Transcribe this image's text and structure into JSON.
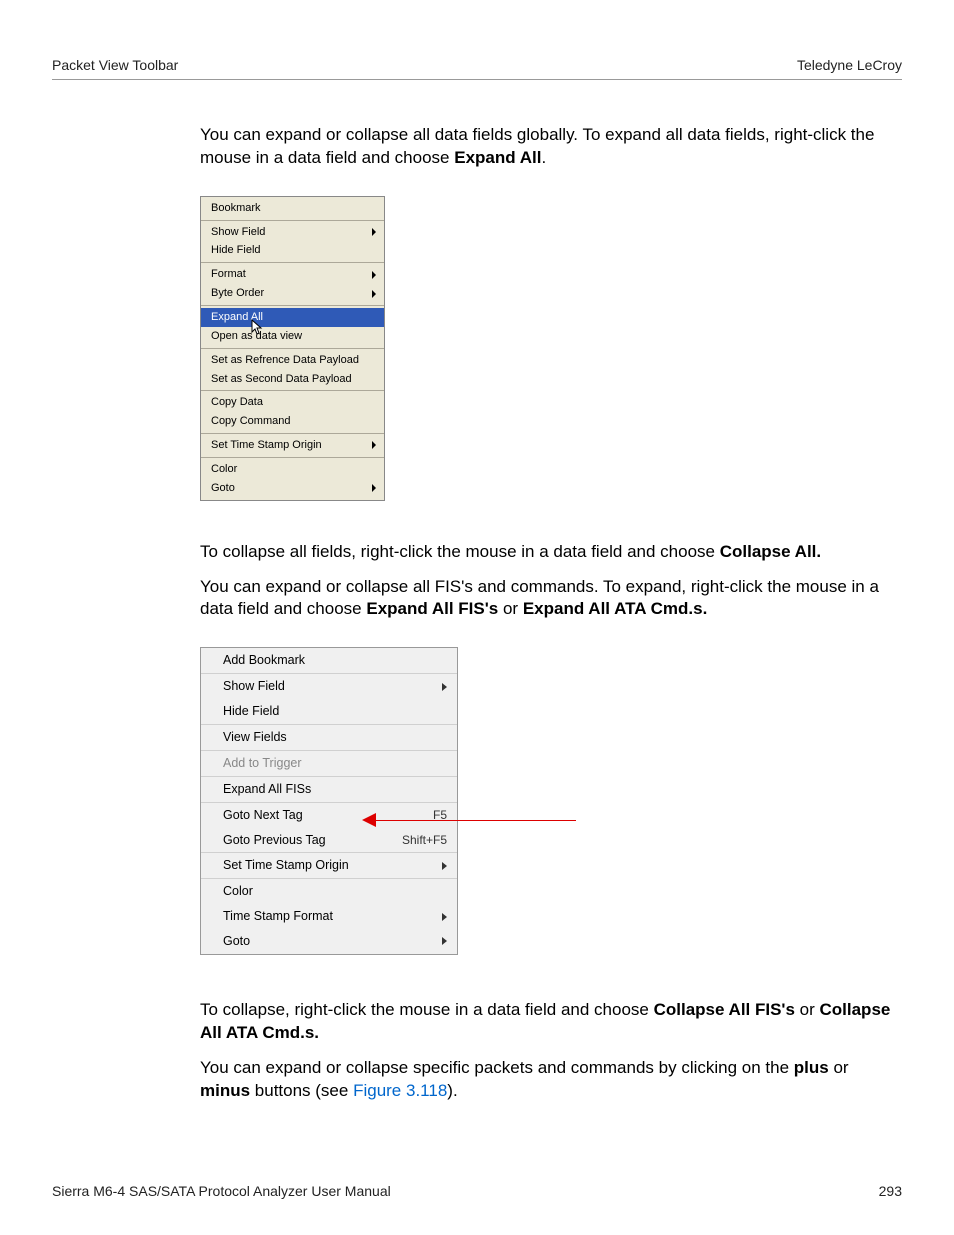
{
  "header": {
    "left": "Packet View Toolbar",
    "right": "Teledyne LeCroy"
  },
  "para1": {
    "pre": "You can expand or collapse all data fields globally. To expand all data fields, right-click the mouse in a data field and choose ",
    "bold": "Expand All",
    "post": "."
  },
  "menu1": {
    "groups": [
      {
        "items": [
          {
            "label": "Bookmark",
            "arrow": false
          }
        ]
      },
      {
        "items": [
          {
            "label": "Show Field",
            "arrow": true
          },
          {
            "label": "Hide Field",
            "arrow": false
          }
        ]
      },
      {
        "items": [
          {
            "label": "Format",
            "arrow": true
          },
          {
            "label": "Byte Order",
            "arrow": true
          }
        ]
      },
      {
        "items": [
          {
            "label": "Expand All",
            "arrow": false,
            "highlight": true
          },
          {
            "label": "Open as data view",
            "arrow": false
          }
        ]
      },
      {
        "items": [
          {
            "label": "Set as Refrence Data Payload",
            "arrow": false
          },
          {
            "label": "Set as Second Data Payload",
            "arrow": false
          }
        ]
      },
      {
        "items": [
          {
            "label": "Copy Data",
            "arrow": false
          },
          {
            "label": "Copy Command",
            "arrow": false
          }
        ]
      },
      {
        "items": [
          {
            "label": "Set Time Stamp Origin",
            "arrow": true
          }
        ]
      },
      {
        "items": [
          {
            "label": "Color",
            "arrow": false
          },
          {
            "label": "Goto",
            "arrow": true
          }
        ]
      }
    ]
  },
  "para2": {
    "pre": "To collapse all fields, right-click the mouse in a data field and choose ",
    "bold": "Collapse All."
  },
  "para3": {
    "pre": "You can expand or collapse all FIS's and commands. To expand, right-click the mouse in a data field and choose ",
    "bold1": "Expand All FIS's",
    "mid": " or ",
    "bold2": "Expand All ATA Cmd.s."
  },
  "menu2": {
    "groups": [
      {
        "items": [
          {
            "label": "Add Bookmark"
          }
        ]
      },
      {
        "items": [
          {
            "label": "Show Field",
            "arrow": true
          },
          {
            "label": "Hide Field"
          }
        ]
      },
      {
        "items": [
          {
            "label": "View Fields"
          }
        ]
      },
      {
        "items": [
          {
            "label": "Add to Trigger",
            "disabled": true
          }
        ]
      },
      {
        "items": [
          {
            "label": "Expand All FISs"
          }
        ]
      },
      {
        "items": [
          {
            "label": "Goto Next Tag",
            "shortcut": "F5"
          },
          {
            "label": "Goto Previous Tag",
            "shortcut": "Shift+F5"
          }
        ]
      },
      {
        "items": [
          {
            "label": "Set Time Stamp Origin",
            "arrow": true
          }
        ]
      },
      {
        "items": [
          {
            "label": "Color"
          },
          {
            "label": "Time Stamp Format",
            "arrow": true
          },
          {
            "label": "Goto",
            "arrow": true
          }
        ]
      }
    ]
  },
  "para4": {
    "pre": "To collapse, right-click the mouse in a data field and choose ",
    "bold1": "Collapse All FIS's",
    "mid": " or ",
    "bold2": "Collapse All ATA Cmd.s."
  },
  "para5": {
    "pre": "You can expand or collapse specific packets and commands by clicking on the ",
    "bold1": "plus",
    "mid1": " or ",
    "bold2": "minus",
    "mid2": " buttons (see ",
    "link": "Figure 3.118",
    "post": ")."
  },
  "footer": {
    "left": "Sierra M6-4 SAS/SATA Protocol Analyzer User Manual",
    "right": "293"
  }
}
